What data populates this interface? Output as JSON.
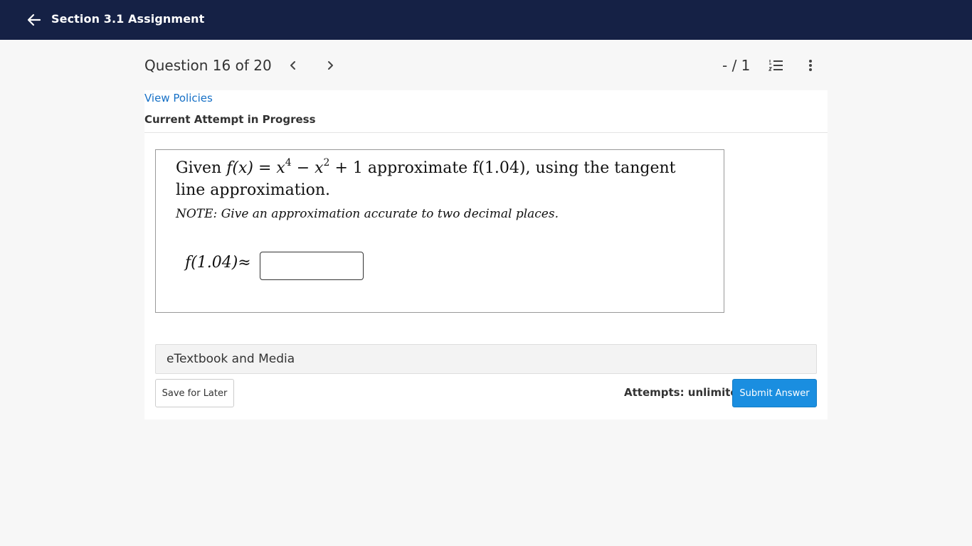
{
  "header": {
    "title": "Section 3.1 Assignment",
    "back_icon": "arrow-left-icon"
  },
  "question_nav": {
    "label": "Question 16 of 20",
    "prev_icon": "chevron-left-icon",
    "next_icon": "chevron-right-icon",
    "score": "- / 1",
    "list_icon": "numbered-list-icon",
    "more_icon": "more-vertical-icon"
  },
  "status": {
    "view_policies": "View Policies",
    "attempt_status": "Current Attempt in Progress"
  },
  "question": {
    "line1_pre": "Given ",
    "line1_fn": "f",
    "line1_expr": "(x) = x",
    "line1_exp1": "4",
    "line1_mid": " − x",
    "line1_exp2": "2",
    "line1_post": " + 1 approximate f(1.04), using the tangent",
    "line2": "line approximation.",
    "note": "NOTE: Give an approximation accurate to two decimal places.",
    "answer_label": "f(1.04)≈",
    "answer_value": "",
    "answer_placeholder": ""
  },
  "etextbook": {
    "label": "eTextbook and Media"
  },
  "footer": {
    "save_label": "Save for Later",
    "attempts": "Attempts: unlimited",
    "submit_label": "Submit Answer"
  },
  "colors": {
    "header_bg": "#152145",
    "link": "#1670c6",
    "submit_bg": "#1a8ee0"
  }
}
